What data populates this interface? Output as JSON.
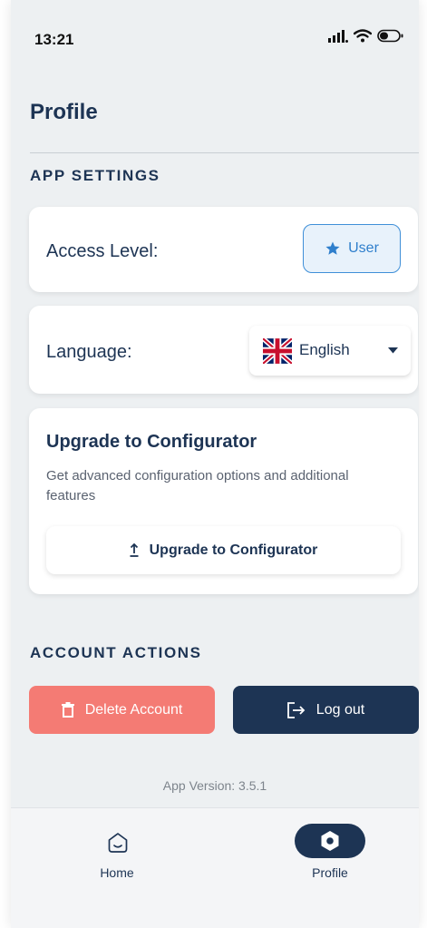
{
  "status_bar": {
    "time": "13:21"
  },
  "page": {
    "title": "Profile"
  },
  "app_settings": {
    "heading": "APP SETTINGS",
    "access_level": {
      "label": "Access Level:",
      "value": "User"
    },
    "language": {
      "label": "Language:",
      "selected": "English"
    },
    "upgrade": {
      "title": "Upgrade to Configurator",
      "description": "Get advanced configuration options and additional features",
      "button_label": "Upgrade to Configurator"
    }
  },
  "account_actions": {
    "heading": "ACCOUNT ACTIONS",
    "delete_label": "Delete Account",
    "logout_label": "Log out"
  },
  "app_version": "App Version: 3.5.1",
  "bottom_nav": {
    "items": [
      {
        "label": "Home",
        "active": false
      },
      {
        "label": "Profile",
        "active": true
      }
    ]
  },
  "colors": {
    "navy": "#1d3454",
    "accent_blue": "#2f7fcc",
    "danger": "#f47b74",
    "background": "#edf0f2"
  }
}
